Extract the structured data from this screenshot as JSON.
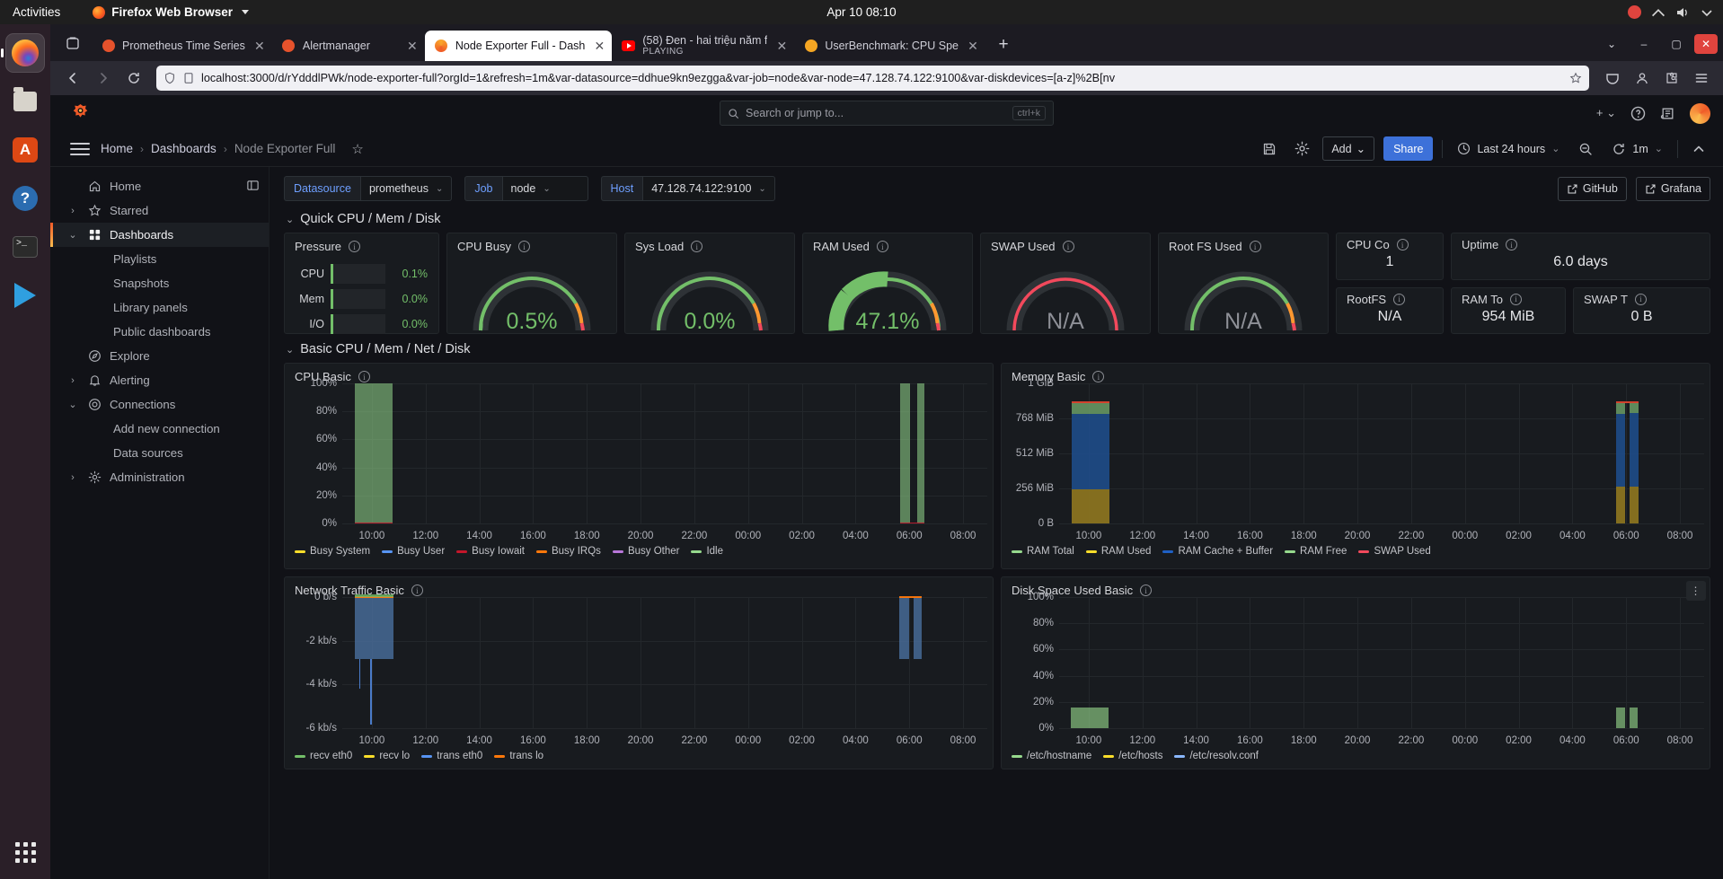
{
  "os": {
    "activities": "Activities",
    "app_menu": "Firefox Web Browser",
    "clock": "Apr 10  08:10",
    "dock": [
      {
        "name": "firefox",
        "label": "Firefox"
      },
      {
        "name": "files",
        "label": "Files"
      },
      {
        "name": "ubuntu-software",
        "label": "Ubuntu Software"
      },
      {
        "name": "help",
        "label": "Help"
      },
      {
        "name": "terminal",
        "label": "Terminal"
      },
      {
        "name": "vscode",
        "label": "Visual Studio Code"
      }
    ]
  },
  "browser": {
    "tabs": [
      {
        "title": "Prometheus Time Series",
        "subtitle": "",
        "icon": "prometheus-favicon",
        "active": false
      },
      {
        "title": "Alertmanager",
        "subtitle": "",
        "icon": "prometheus-favicon",
        "active": false
      },
      {
        "title": "Node Exporter Full - Dash",
        "subtitle": "",
        "icon": "grafana-favicon",
        "active": true
      },
      {
        "title": "(58) Đen - hai triệu năm f",
        "subtitle": "PLAYING",
        "icon": "youtube-favicon",
        "active": false
      },
      {
        "title": "UserBenchmark: CPU Spe",
        "subtitle": "",
        "icon": "userbenchmark-favicon",
        "active": false
      }
    ],
    "new_tab_label": "+",
    "url": "localhost:3000/d/rYdddlPWk/node-exporter-full?orgId=1&refresh=1m&var-datasource=ddhue9kn9ezgga&var-job=node&var-node=47.128.74.122:9100&var-diskdevices=[a-z]%2B[nv",
    "url_host": "localhost",
    "window_buttons": {
      "minimize": "‒",
      "maximize": "▢",
      "close": "✕"
    }
  },
  "grafana": {
    "search_placeholder": "Search or jump to...",
    "search_kbd": "ctrl+k",
    "breadcrumb": [
      {
        "label": "Home",
        "current": false
      },
      {
        "label": "Dashboards",
        "current": false
      },
      {
        "label": "Node Exporter Full",
        "current": true
      }
    ],
    "toolbar": {
      "save_label": "Save dashboard",
      "settings_label": "Dashboard settings",
      "add_label": "Add",
      "share_label": "Share",
      "time_range": "Last 24 hours",
      "zoom_out_label": "Zoom out time range",
      "refresh_interval": "1m",
      "collapse_label": "Collapse"
    },
    "sidebar": [
      {
        "label": "Home",
        "icon": "home-icon",
        "expandable": false,
        "active": false,
        "sub": false
      },
      {
        "label": "Starred",
        "icon": "star-icon",
        "expandable": true,
        "chev": "›",
        "active": false,
        "sub": false
      },
      {
        "label": "Dashboards",
        "icon": "dashboards-icon",
        "expandable": true,
        "chev": "⌄",
        "active": true,
        "sub": false
      },
      {
        "label": "Playlists",
        "icon": "",
        "expandable": false,
        "active": false,
        "sub": true
      },
      {
        "label": "Snapshots",
        "icon": "",
        "expandable": false,
        "active": false,
        "sub": true
      },
      {
        "label": "Library panels",
        "icon": "",
        "expandable": false,
        "active": false,
        "sub": true
      },
      {
        "label": "Public dashboards",
        "icon": "",
        "expandable": false,
        "active": false,
        "sub": true
      },
      {
        "label": "Explore",
        "icon": "compass-icon",
        "expandable": false,
        "active": false,
        "sub": false
      },
      {
        "label": "Alerting",
        "icon": "bell-icon",
        "expandable": true,
        "chev": "›",
        "active": false,
        "sub": false
      },
      {
        "label": "Connections",
        "icon": "connections-icon",
        "expandable": true,
        "chev": "⌄",
        "active": false,
        "sub": false
      },
      {
        "label": "Add new connection",
        "icon": "",
        "expandable": false,
        "active": false,
        "sub": true
      },
      {
        "label": "Data sources",
        "icon": "",
        "expandable": false,
        "active": false,
        "sub": true
      },
      {
        "label": "Administration",
        "icon": "gear-icon",
        "expandable": true,
        "chev": "›",
        "active": false,
        "sub": false
      }
    ],
    "variables": [
      {
        "key": "Datasource",
        "value": "prometheus"
      },
      {
        "key": "Job",
        "value": "node"
      },
      {
        "key": "Host",
        "value": "47.128.74.122:9100"
      }
    ],
    "links": [
      {
        "label": "GitHub",
        "icon": "external-link-icon"
      },
      {
        "label": "Grafana",
        "icon": "external-link-icon"
      }
    ],
    "sections": [
      {
        "title": "Quick CPU / Mem / Disk",
        "collapsed": false
      },
      {
        "title": "Basic CPU / Mem / Net / Disk",
        "collapsed": false
      }
    ],
    "panels": {
      "pressure": {
        "title": "Pressure",
        "rows": [
          {
            "label": "CPU",
            "value": "0.1%",
            "pct": 0.1
          },
          {
            "label": "Mem",
            "value": "0.0%",
            "pct": 0.0
          },
          {
            "label": "I/O",
            "value": "0.0%",
            "pct": 0.0
          }
        ]
      },
      "cpu_busy": {
        "title": "CPU Busy",
        "value": "0.5%",
        "pct": 0.5,
        "color": "#73bf69"
      },
      "sys_load": {
        "title": "Sys Load",
        "value": "0.0%",
        "pct": 0.0,
        "color": "#73bf69"
      },
      "ram_used": {
        "title": "RAM Used",
        "value": "47.1%",
        "pct": 47.1,
        "color": "#73bf69"
      },
      "swap_used": {
        "title": "SWAP Used",
        "value": "N/A",
        "pct": 0,
        "color": "#8e9097"
      },
      "root_fs_used": {
        "title": "Root FS Used",
        "value": "N/A",
        "pct": 0,
        "color": "#8e9097"
      },
      "cpu_cores": {
        "title": "CPU Co",
        "value": "1"
      },
      "uptime": {
        "title": "Uptime",
        "value": "6.0 days"
      },
      "rootfs_total": {
        "title": "RootFS",
        "value": "N/A"
      },
      "ram_total": {
        "title": "RAM To",
        "value": "954 MiB"
      },
      "swap_total": {
        "title": "SWAP T",
        "value": "0 B"
      }
    }
  },
  "chart_data": [
    {
      "type": "area",
      "panel": "cpu-basic",
      "title": "CPU Basic",
      "xlabel": "",
      "ylabel": "",
      "ylim": [
        0,
        100
      ],
      "yticks": [
        "0%",
        "20%",
        "40%",
        "60%",
        "80%",
        "100%"
      ],
      "xticks": [
        "10:00",
        "12:00",
        "14:00",
        "16:00",
        "18:00",
        "20:00",
        "22:00",
        "00:00",
        "02:00",
        "04:00",
        "06:00",
        "08:00"
      ],
      "grid": true,
      "legend_position": "bottom",
      "series": [
        {
          "name": "Busy System",
          "color": "#fade2a"
        },
        {
          "name": "Busy User",
          "color": "#5794f2"
        },
        {
          "name": "Busy Iowait",
          "color": "#c4162a"
        },
        {
          "name": "Busy IRQs",
          "color": "#ff780a"
        },
        {
          "name": "Busy Other",
          "color": "#b877d9"
        },
        {
          "name": "Idle",
          "color": "#96d98d"
        }
      ],
      "bands": [
        {
          "series": "Idle",
          "x_start": "09:20",
          "x_end": "10:50",
          "value": 100
        },
        {
          "series": "Idle",
          "x_start": "07:20",
          "x_end": "07:40",
          "value": 100
        },
        {
          "series": "Idle",
          "x_start": "07:55",
          "x_end": "08:10",
          "value": 100
        }
      ]
    },
    {
      "type": "area",
      "panel": "memory-basic",
      "title": "Memory Basic",
      "xlabel": "",
      "ylabel": "",
      "ylim": [
        0,
        1073741824
      ],
      "yticks": [
        "0 B",
        "256 MiB",
        "512 MiB",
        "768 MiB",
        "1 GiB"
      ],
      "xticks": [
        "10:00",
        "12:00",
        "14:00",
        "16:00",
        "18:00",
        "20:00",
        "22:00",
        "00:00",
        "02:00",
        "04:00",
        "06:00",
        "08:00"
      ],
      "grid": true,
      "legend_position": "bottom",
      "series": [
        {
          "name": "RAM Total",
          "color": "#96d98d"
        },
        {
          "name": "RAM Used",
          "color": "#fade2a"
        },
        {
          "name": "RAM Cache + Buffer",
          "color": "#1f60c4"
        },
        {
          "name": "RAM Free",
          "color": "#96d98d"
        },
        {
          "name": "SWAP Used",
          "color": "#f2495c"
        }
      ],
      "bands": [
        {
          "series": "RAM Used",
          "x_start": "09:20",
          "x_end": "10:50",
          "value_mib": 262
        },
        {
          "series": "RAM Cache + Buffer",
          "x_start": "09:20",
          "x_end": "10:50",
          "value_mib": 820
        },
        {
          "series": "RAM Free",
          "x_start": "09:20",
          "x_end": "10:50",
          "value_mib": 930
        },
        {
          "series": "RAM Used",
          "x_start": "07:20",
          "x_end": "08:10",
          "value_mib": 280
        }
      ]
    },
    {
      "type": "area",
      "panel": "network-traffic-basic",
      "title": "Network Traffic Basic",
      "xlabel": "",
      "ylabel": "",
      "ylim": [
        -6000,
        0
      ],
      "yticks": [
        "-6 kb/s",
        "-4 kb/s",
        "-2 kb/s",
        "0 b/s"
      ],
      "xticks": [
        "10:00",
        "12:00",
        "14:00",
        "16:00",
        "18:00",
        "20:00",
        "22:00",
        "00:00",
        "02:00",
        "04:00",
        "06:00",
        "08:00"
      ],
      "grid": true,
      "legend_position": "bottom",
      "series": [
        {
          "name": "recv eth0",
          "color": "#73bf69"
        },
        {
          "name": "recv lo",
          "color": "#fade2a"
        },
        {
          "name": "trans eth0",
          "color": "#5794f2"
        },
        {
          "name": "trans lo",
          "color": "#ff780a"
        }
      ],
      "bands": [
        {
          "series": "trans eth0",
          "x_start": "09:20",
          "x_end": "10:50",
          "value": -2800,
          "spike_min": -5900
        }
      ]
    },
    {
      "type": "area",
      "panel": "disk-space-used-basic",
      "title": "Disk Space Used Basic",
      "xlabel": "",
      "ylabel": "",
      "ylim": [
        0,
        100
      ],
      "yticks": [
        "0%",
        "20%",
        "40%",
        "60%",
        "80%",
        "100%"
      ],
      "xticks": [
        "10:00",
        "12:00",
        "14:00",
        "16:00",
        "18:00",
        "20:00",
        "22:00",
        "00:00",
        "02:00",
        "04:00",
        "06:00",
        "08:00"
      ],
      "grid": true,
      "legend_position": "bottom",
      "series": [
        {
          "name": "/etc/hostname",
          "color": "#96d98d"
        },
        {
          "name": "/etc/hosts",
          "color": "#fade2a"
        },
        {
          "name": "/etc/resolv.conf",
          "color": "#8ab8ff"
        }
      ],
      "bands": [
        {
          "series": "/etc/hostname",
          "x_start": "09:20",
          "x_end": "10:50",
          "value": 15.5
        },
        {
          "series": "/etc/hostname",
          "x_start": "07:20",
          "x_end": "08:10",
          "value": 15.5
        }
      ]
    }
  ]
}
